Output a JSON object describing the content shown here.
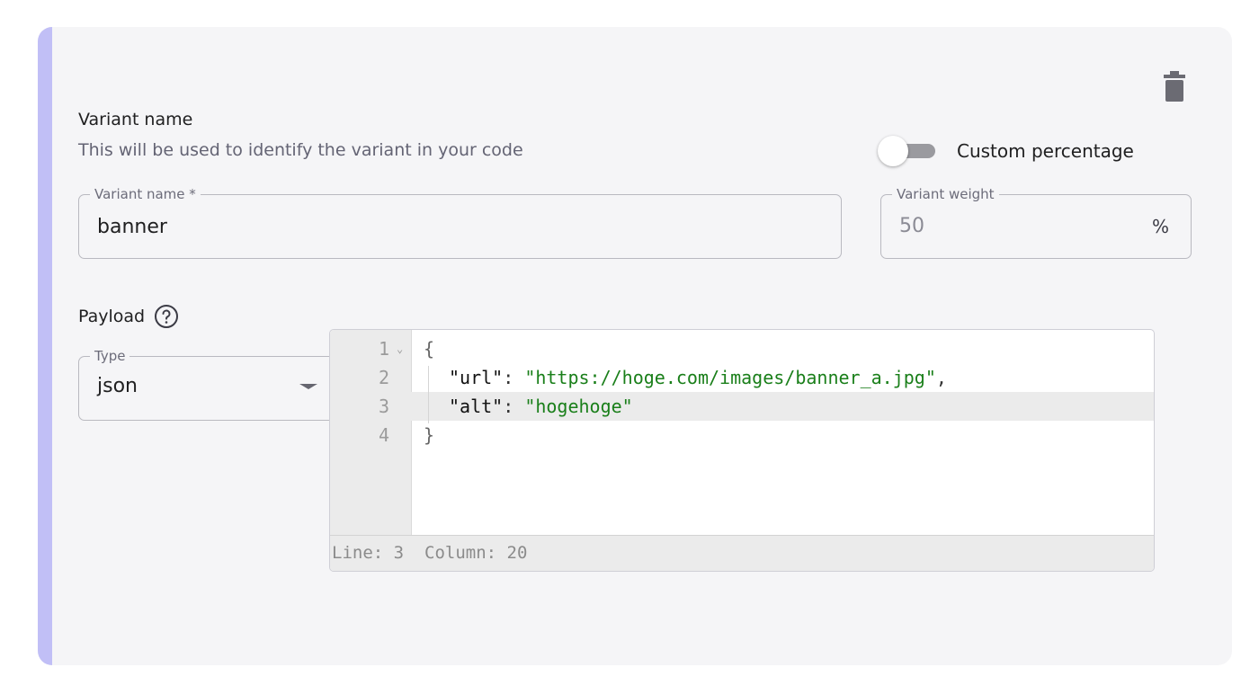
{
  "variant": {
    "section_title": "Variant name",
    "section_description": "This will be used to identify the variant in your code",
    "custom_percentage_label": "Custom percentage",
    "custom_percentage_enabled": false,
    "name_field": {
      "label": "Variant name *",
      "value": "banner"
    },
    "weight_field": {
      "label": "Variant weight",
      "value": "50",
      "suffix": "%"
    }
  },
  "payload": {
    "label": "Payload",
    "type_field": {
      "label": "Type",
      "value": "json"
    },
    "editor": {
      "lines": [
        {
          "num": "1",
          "brace": "{"
        },
        {
          "num": "2",
          "key": "\"url\"",
          "sep": ": ",
          "str": "\"https://hoge.com/images/banner_a.jpg\"",
          "trail": ","
        },
        {
          "num": "3",
          "key": "\"alt\"",
          "sep": ": ",
          "str": "\"hogehoge\"",
          "trail": ""
        },
        {
          "num": "4",
          "brace": "}"
        }
      ],
      "active_line": 3,
      "status": {
        "line_label": "Line:",
        "line_value": "3",
        "column_label": "Column:",
        "column_value": "20"
      }
    }
  },
  "icons": {
    "delete": "trash-icon",
    "help": "help-circle-icon",
    "dropdown": "caret-down-icon",
    "fold": "chevron-down-icon"
  },
  "colors": {
    "accent": "#c1bff6",
    "card_background": "#f5f5f7",
    "string": "#1a7f1a"
  }
}
